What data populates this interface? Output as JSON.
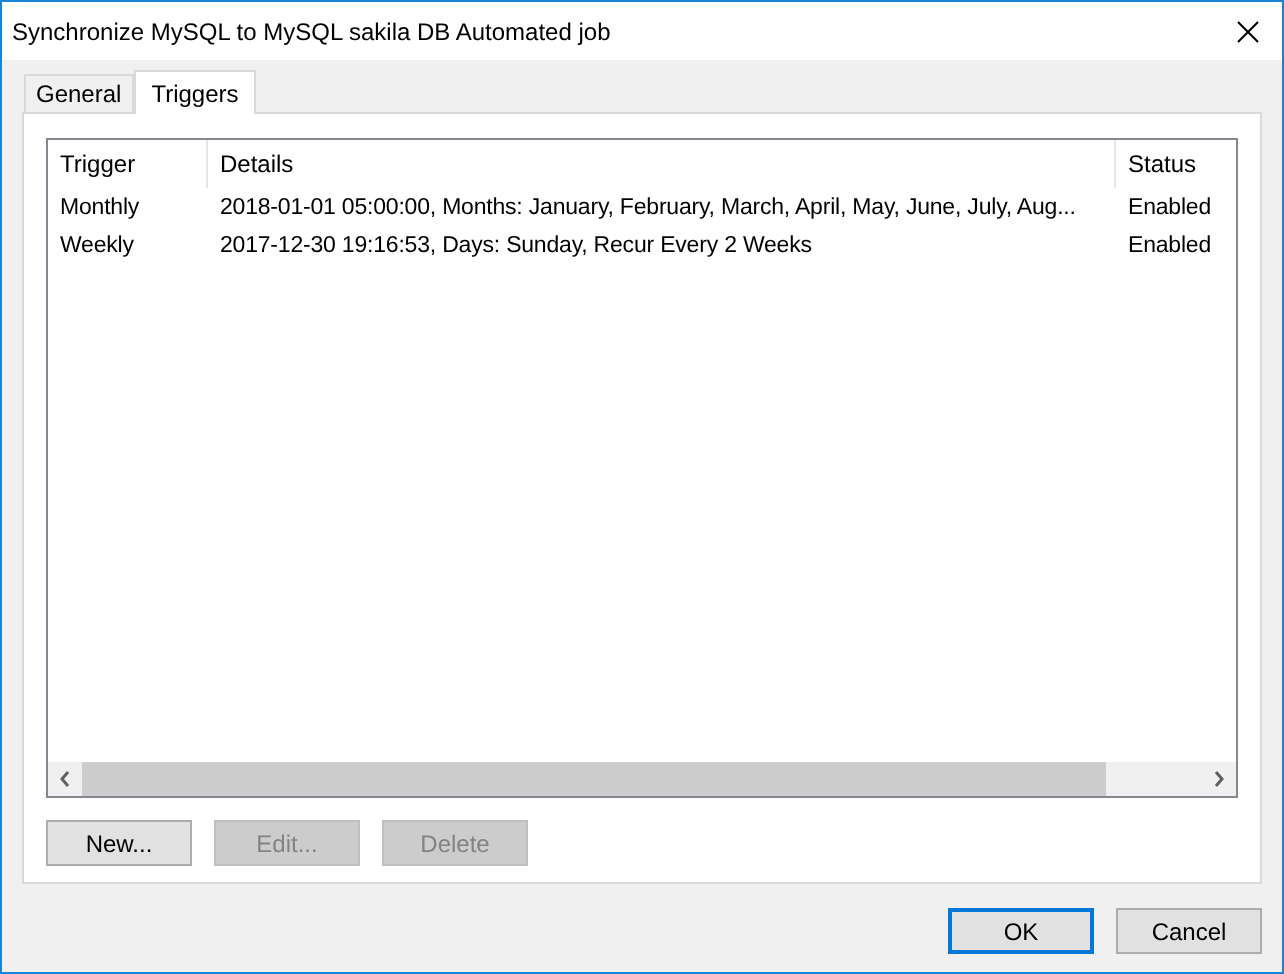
{
  "window": {
    "title": "Synchronize MySQL to MySQL sakila DB Automated job"
  },
  "tabs": [
    {
      "label": "General",
      "selected": false
    },
    {
      "label": "Triggers",
      "selected": true
    }
  ],
  "table": {
    "columns": [
      "Trigger",
      "Details",
      "Status"
    ],
    "rows": [
      [
        "Monthly",
        "2018-01-01 05:00:00, Months: January, February, March, April, May, June, July, Aug...",
        "Enabled"
      ],
      [
        "Weekly",
        "2017-12-30 19:16:53, Days: Sunday, Recur Every 2 Weeks",
        "Enabled"
      ]
    ]
  },
  "list_buttons": [
    {
      "label": "New...",
      "disabled": false
    },
    {
      "label": "Edit...",
      "disabled": true
    },
    {
      "label": "Delete",
      "disabled": true
    }
  ],
  "dialog_buttons": [
    {
      "label": "OK",
      "default": true
    },
    {
      "label": "Cancel",
      "default": false
    }
  ]
}
